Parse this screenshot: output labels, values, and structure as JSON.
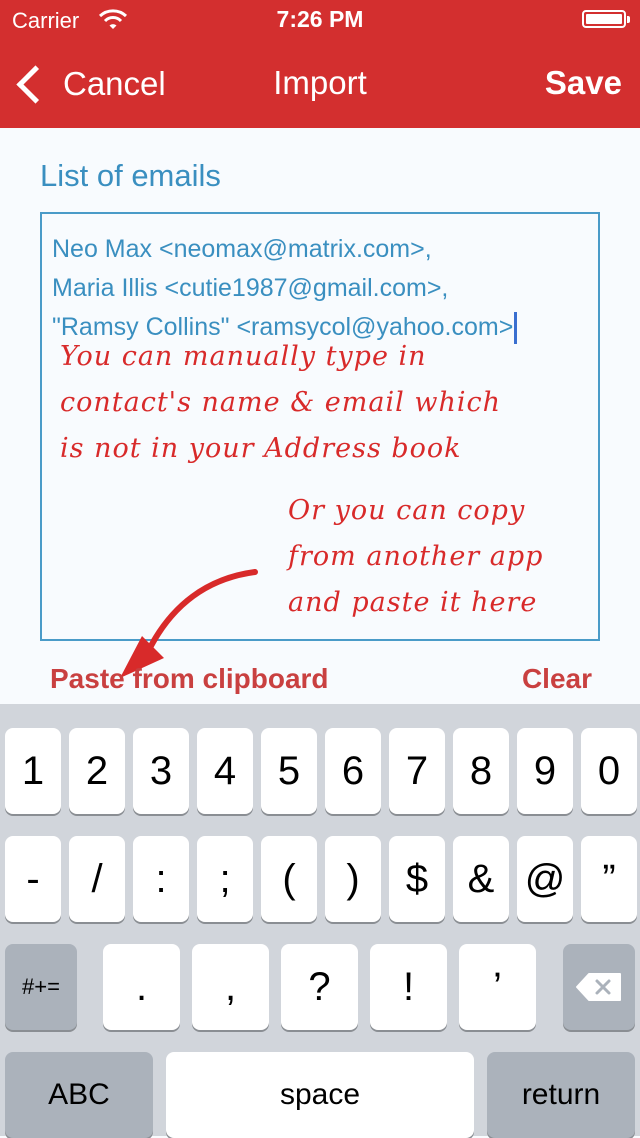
{
  "status_bar": {
    "carrier": "Carrier",
    "time": "7:26 PM"
  },
  "nav": {
    "cancel_label": "Cancel",
    "title": "Import",
    "save_label": "Save"
  },
  "form": {
    "label": "List of emails",
    "emails_text": "Neo Max <neomax@matrix.com>,\nMaria Illis <cutie1987@gmail.com>,\n\"Ramsy Collins\" <ramsycol@yahoo.com>",
    "note_primary": "You can manually type in\ncontact's name & email which\nis not in your Address book",
    "note_secondary": "Or you can copy\nfrom another app\nand paste it here",
    "paste_label": "Paste from clipboard",
    "clear_label": "Clear"
  },
  "keyboard": {
    "row1": [
      "1",
      "2",
      "3",
      "4",
      "5",
      "6",
      "7",
      "8",
      "9",
      "0"
    ],
    "row2": [
      "-",
      "/",
      ":",
      ";",
      "(",
      ")",
      "$",
      "&",
      "@",
      "”"
    ],
    "row3": {
      "mode": "#+=",
      "keys": [
        ".",
        ",",
        "?",
        "!",
        "’"
      ]
    },
    "row4": {
      "abc": "ABC",
      "space": "space",
      "return": "return"
    }
  },
  "colors": {
    "nav_bg": "#d32f2f",
    "accent_blue": "#3a8fc0",
    "annotation_red": "#d82a2a",
    "action_red": "#c94040"
  },
  "icons": [
    "wifi-icon",
    "battery-icon",
    "chevron-left-icon",
    "backspace-icon",
    "arrow-annotation"
  ]
}
